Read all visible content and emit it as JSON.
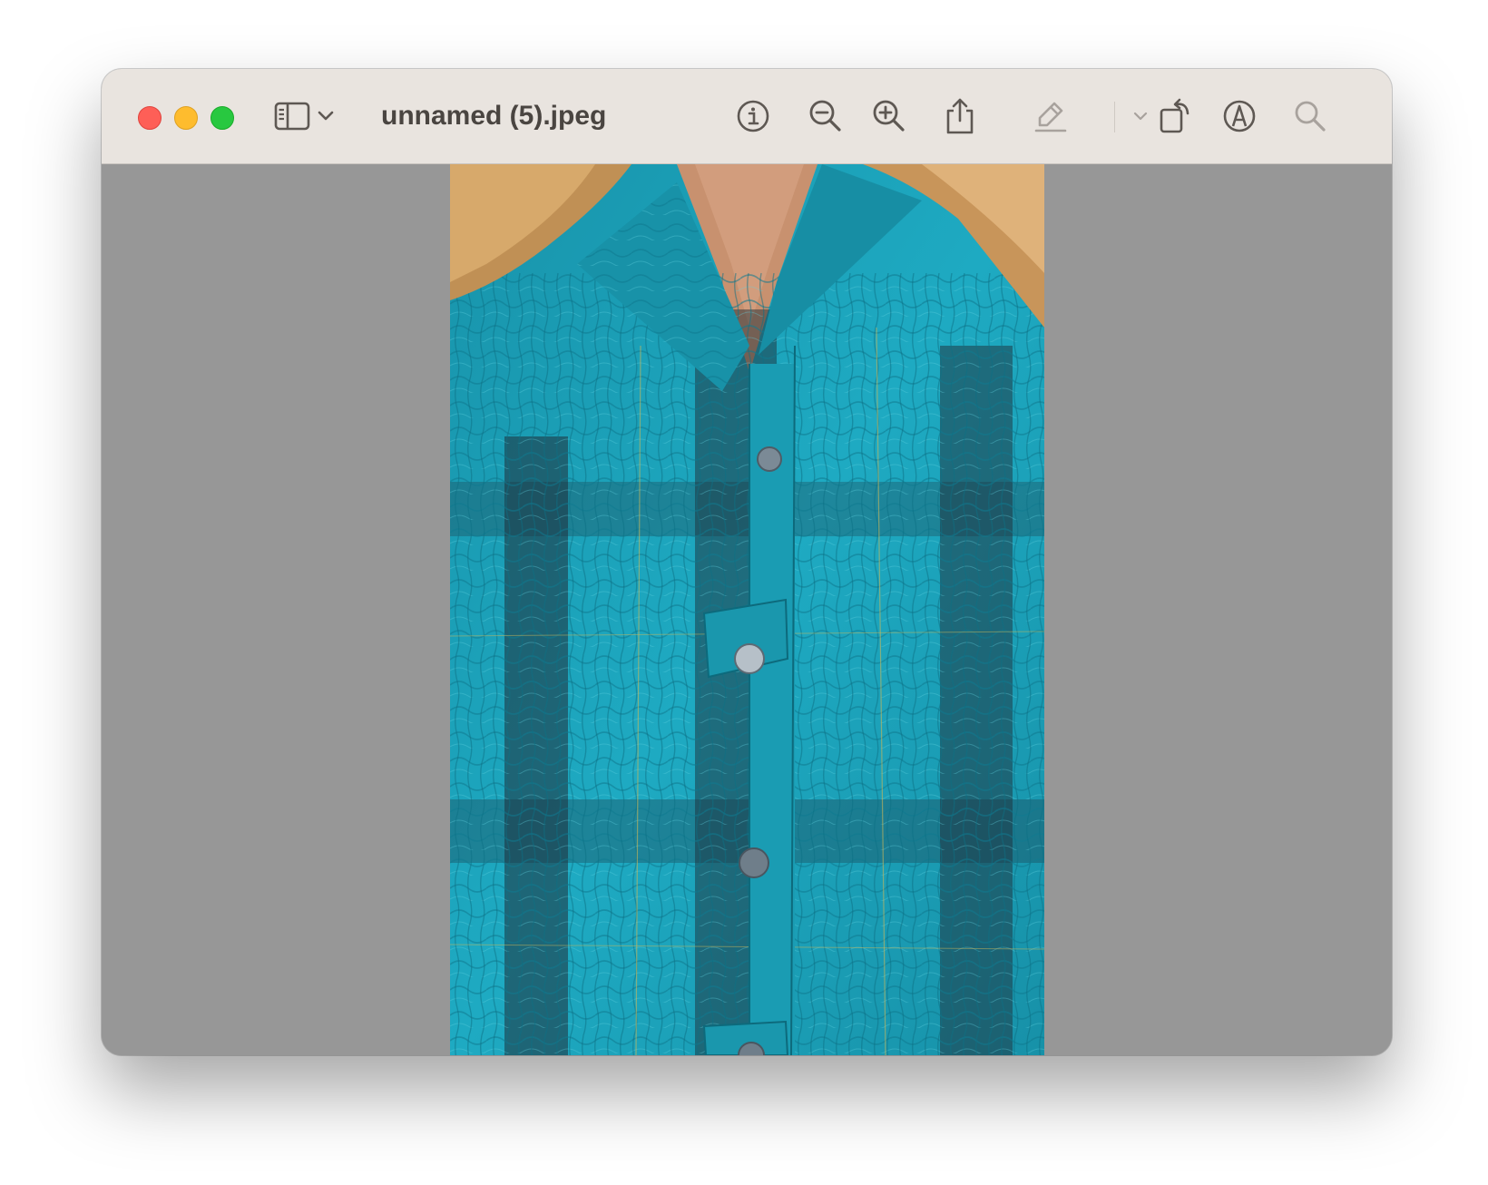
{
  "window": {
    "title": "unnamed (5).jpeg"
  },
  "toolbar": {
    "traffic_lights": [
      "close",
      "minimize",
      "zoom"
    ],
    "buttons": [
      {
        "name": "sidebar-toggle",
        "icon": "sidebar-icon"
      },
      {
        "name": "sidebar-menu",
        "icon": "chevron-down-icon"
      },
      {
        "name": "get-info",
        "icon": "info-icon"
      },
      {
        "name": "zoom-out",
        "icon": "zoom-out-icon"
      },
      {
        "name": "zoom-in",
        "icon": "zoom-in-icon"
      },
      {
        "name": "share",
        "icon": "share-icon"
      },
      {
        "name": "highlight",
        "icon": "highlighter-icon"
      },
      {
        "name": "highlight-menu",
        "icon": "chevron-down-icon"
      },
      {
        "name": "rotate",
        "icon": "rotate-icon"
      },
      {
        "name": "markup",
        "icon": "markup-icon"
      },
      {
        "name": "search",
        "icon": "search-icon"
      }
    ]
  },
  "viewer": {
    "image": "photo of a teal plaid crinkled button-up blouse with collar and pocket flap, blonde hair at top",
    "colors": {
      "canvas_background": "#979797",
      "titlebar_background": "#e9e4df",
      "fabric": "#1aa1b8",
      "plaid_dark": "#1f2f3a"
    }
  }
}
